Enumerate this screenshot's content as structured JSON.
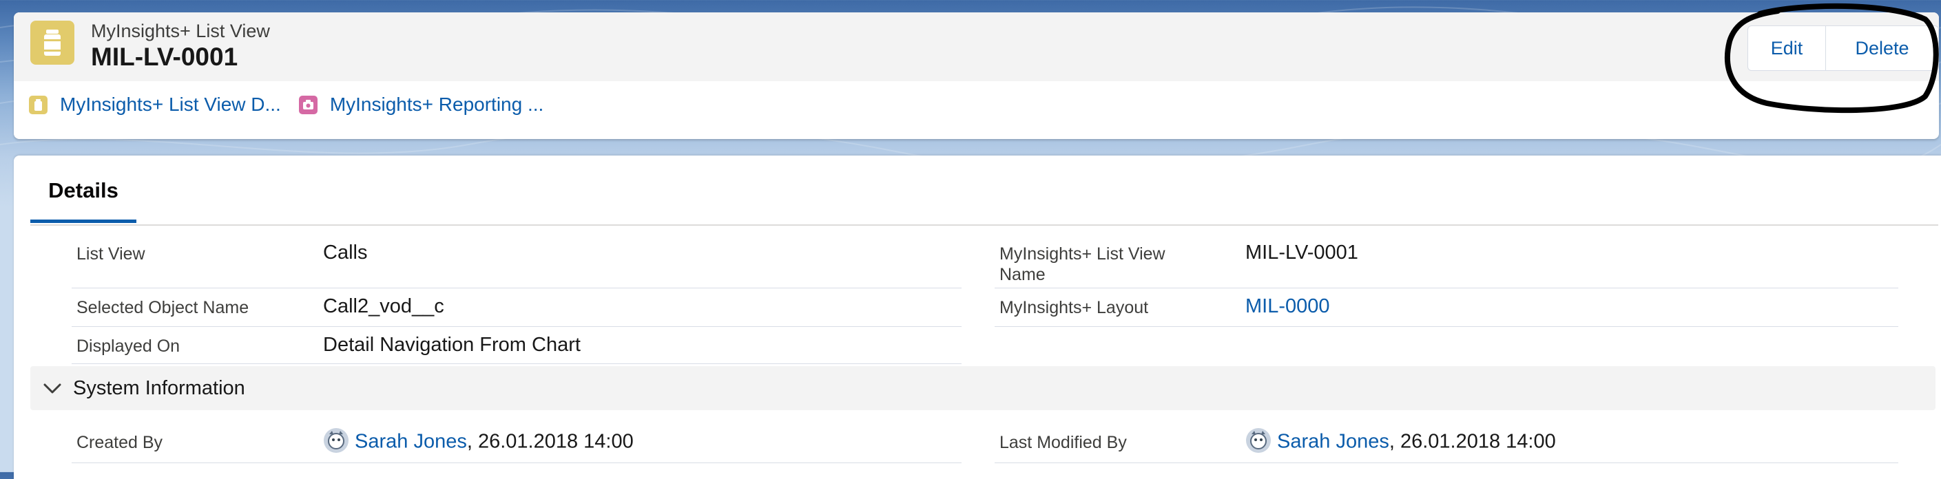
{
  "header": {
    "object_label": "MyInsights+ List View",
    "record_title": "MIL-LV-0001",
    "record_icon": "clipboard-can-icon",
    "buttons": {
      "edit": "Edit",
      "delete": "Delete"
    },
    "related": [
      {
        "label": "MyInsights+ List View D...",
        "icon": "list-view-icon",
        "color": "#e2cb6b"
      },
      {
        "label": "MyInsights+ Reporting ...",
        "icon": "camera-icon",
        "color": "#d569a4"
      }
    ]
  },
  "details": {
    "tab_label": "Details",
    "fields": {
      "list_view": {
        "label": "List View",
        "value": "Calls"
      },
      "list_view_name": {
        "label": "MyInsights+ List View Name",
        "value": "MIL-LV-0001"
      },
      "selected_object": {
        "label": "Selected Object Name",
        "value": "Call2_vod__c"
      },
      "layout": {
        "label": "MyInsights+ Layout",
        "value": "MIL-0000"
      },
      "displayed_on": {
        "label": "Displayed On",
        "value": "Detail Navigation From Chart"
      }
    },
    "system_section": {
      "title": "System Information",
      "created_by": {
        "label": "Created By",
        "user": "Sarah Jones",
        "date": ", 26.01.2018 14:00"
      },
      "modified_by": {
        "label": "Last Modified By",
        "user": "Sarah Jones",
        "date": ", 26.01.2018 14:00"
      }
    }
  },
  "colors": {
    "link": "#0b5cab",
    "accent": "#0b5cab",
    "annotation": "#000000"
  }
}
